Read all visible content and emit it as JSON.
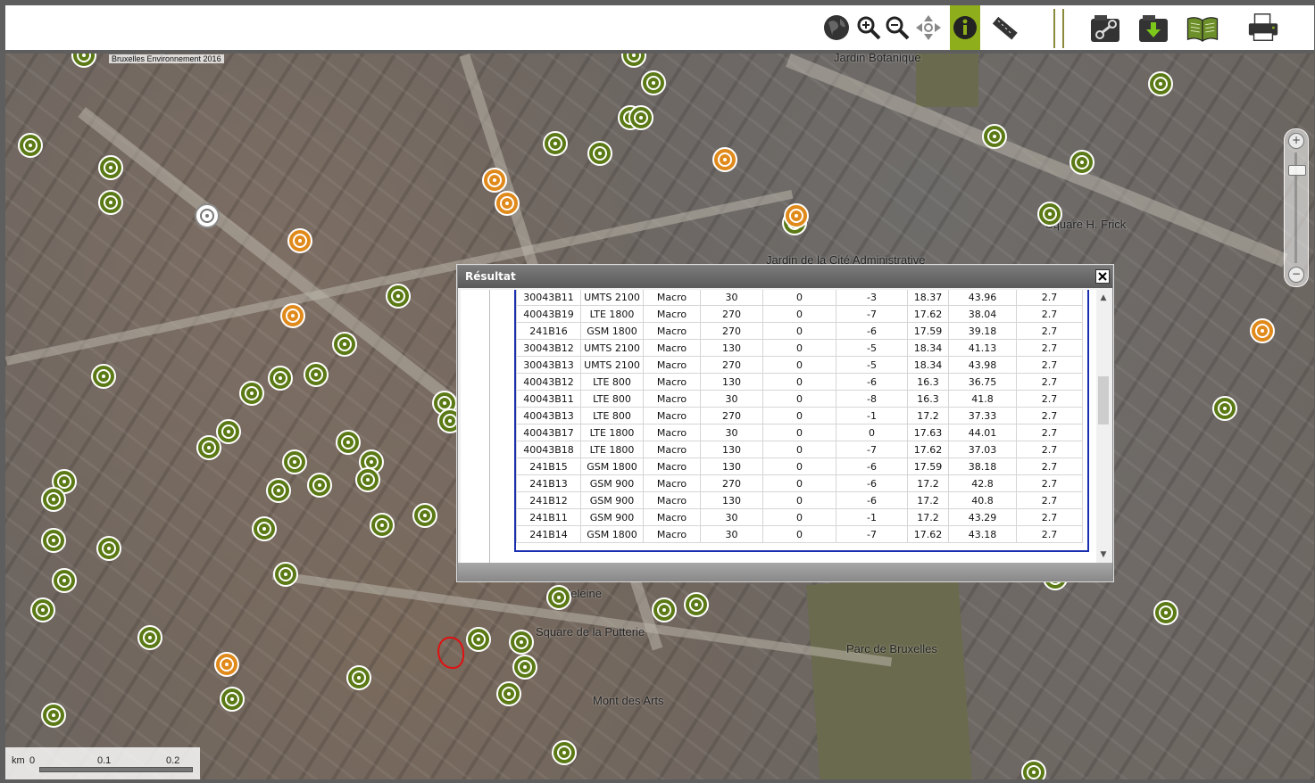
{
  "toolbar": {
    "buttons": [
      {
        "name": "globe-button",
        "icon": "globe-icon"
      },
      {
        "name": "zoom-in-button",
        "icon": "zoom-in-icon"
      },
      {
        "name": "zoom-out-button",
        "icon": "zoom-out-icon"
      },
      {
        "name": "pan-button",
        "icon": "pan-icon"
      },
      {
        "name": "info-button",
        "icon": "info-icon",
        "active": true
      },
      {
        "name": "measure-button",
        "icon": "ruler-icon"
      },
      {
        "name": "link-button",
        "icon": "link-icon"
      },
      {
        "name": "download-button",
        "icon": "download-icon"
      },
      {
        "name": "help-book-button",
        "icon": "book-icon"
      },
      {
        "name": "print-button",
        "icon": "printer-icon"
      }
    ]
  },
  "map": {
    "copyright": "Bruxelles Environnement 2016",
    "labels": [
      "Jardin Botanique",
      "Square H. Frick",
      "Jardin de la Cité Administrative",
      "Madeleine",
      "Square de la Putterie",
      "Parc de Bruxelles",
      "Mont des Arts"
    ],
    "marker_colors": {
      "operational": "#5b7a16",
      "planned": "#e08a1c",
      "other": "#ffffff"
    }
  },
  "scale": {
    "unit": "km",
    "ticks": [
      "0",
      "0.1",
      "0.2"
    ]
  },
  "dialog": {
    "title": "Résultat",
    "close_label": "X",
    "rows": [
      [
        "30043B11",
        "UMTS 2100",
        "Macro",
        "30",
        "0",
        "-3",
        "18.37",
        "43.96",
        "2.7"
      ],
      [
        "40043B19",
        "LTE 1800",
        "Macro",
        "270",
        "0",
        "-7",
        "17.62",
        "38.04",
        "2.7"
      ],
      [
        "241B16",
        "GSM 1800",
        "Macro",
        "270",
        "0",
        "-6",
        "17.59",
        "39.18",
        "2.7"
      ],
      [
        "30043B12",
        "UMTS 2100",
        "Macro",
        "130",
        "0",
        "-5",
        "18.34",
        "41.13",
        "2.7"
      ],
      [
        "30043B13",
        "UMTS 2100",
        "Macro",
        "270",
        "0",
        "-5",
        "18.34",
        "43.98",
        "2.7"
      ],
      [
        "40043B12",
        "LTE 800",
        "Macro",
        "130",
        "0",
        "-6",
        "16.3",
        "36.75",
        "2.7"
      ],
      [
        "40043B11",
        "LTE 800",
        "Macro",
        "30",
        "0",
        "-8",
        "16.3",
        "41.8",
        "2.7"
      ],
      [
        "40043B13",
        "LTE 800",
        "Macro",
        "270",
        "0",
        "-1",
        "17.2",
        "37.33",
        "2.7"
      ],
      [
        "40043B17",
        "LTE 1800",
        "Macro",
        "30",
        "0",
        "0",
        "17.63",
        "44.01",
        "2.7"
      ],
      [
        "40043B18",
        "LTE 1800",
        "Macro",
        "130",
        "0",
        "-7",
        "17.62",
        "37.03",
        "2.7"
      ],
      [
        "241B15",
        "GSM 1800",
        "Macro",
        "130",
        "0",
        "-6",
        "17.59",
        "38.18",
        "2.7"
      ],
      [
        "241B13",
        "GSM 900",
        "Macro",
        "270",
        "0",
        "-6",
        "17.2",
        "42.8",
        "2.7"
      ],
      [
        "241B12",
        "GSM 900",
        "Macro",
        "130",
        "0",
        "-6",
        "17.2",
        "40.8",
        "2.7"
      ],
      [
        "241B11",
        "GSM 900",
        "Macro",
        "30",
        "0",
        "-1",
        "17.2",
        "43.29",
        "2.7"
      ],
      [
        "241B14",
        "GSM 1800",
        "Macro",
        "30",
        "0",
        "-7",
        "17.62",
        "43.18",
        "2.7"
      ]
    ]
  }
}
